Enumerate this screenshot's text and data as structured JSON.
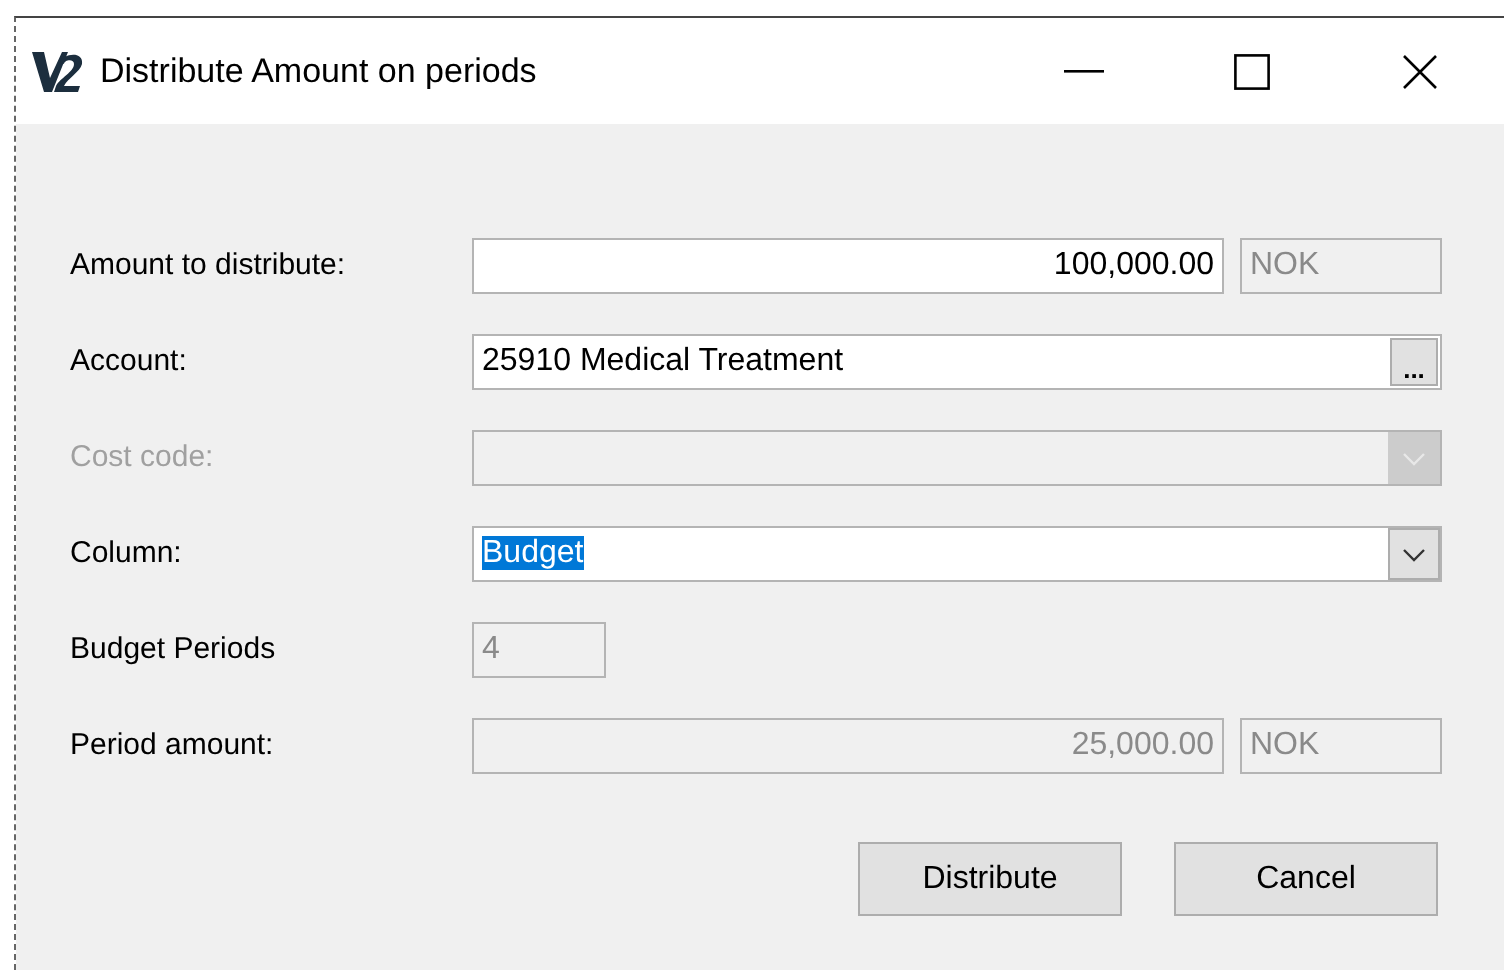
{
  "window": {
    "title": "Distribute Amount on periods"
  },
  "fields": [
    {
      "kind": "amount",
      "label": "Amount to distribute:",
      "value": "100,000.00",
      "currency": "NOK",
      "disabled": false,
      "readonly": false
    },
    {
      "kind": "lookup",
      "label": "Account:",
      "value": "25910 Medical Treatment",
      "button_label": "...",
      "disabled": false,
      "readonly": false
    },
    {
      "kind": "combo",
      "label": "Cost code:",
      "disabled": true,
      "readonly": true
    },
    {
      "kind": "combo",
      "label": "Column:",
      "value": "Budget",
      "text_selected": true,
      "disabled": false,
      "readonly": false
    },
    {
      "kind": "short",
      "label": "Budget Periods",
      "value": "4",
      "disabled": false,
      "readonly": true
    },
    {
      "kind": "amount",
      "label": "Period amount:",
      "value": "25,000.00",
      "currency": "NOK",
      "disabled": false,
      "readonly": true
    }
  ],
  "buttons": [
    "Distribute",
    "Cancel"
  ]
}
